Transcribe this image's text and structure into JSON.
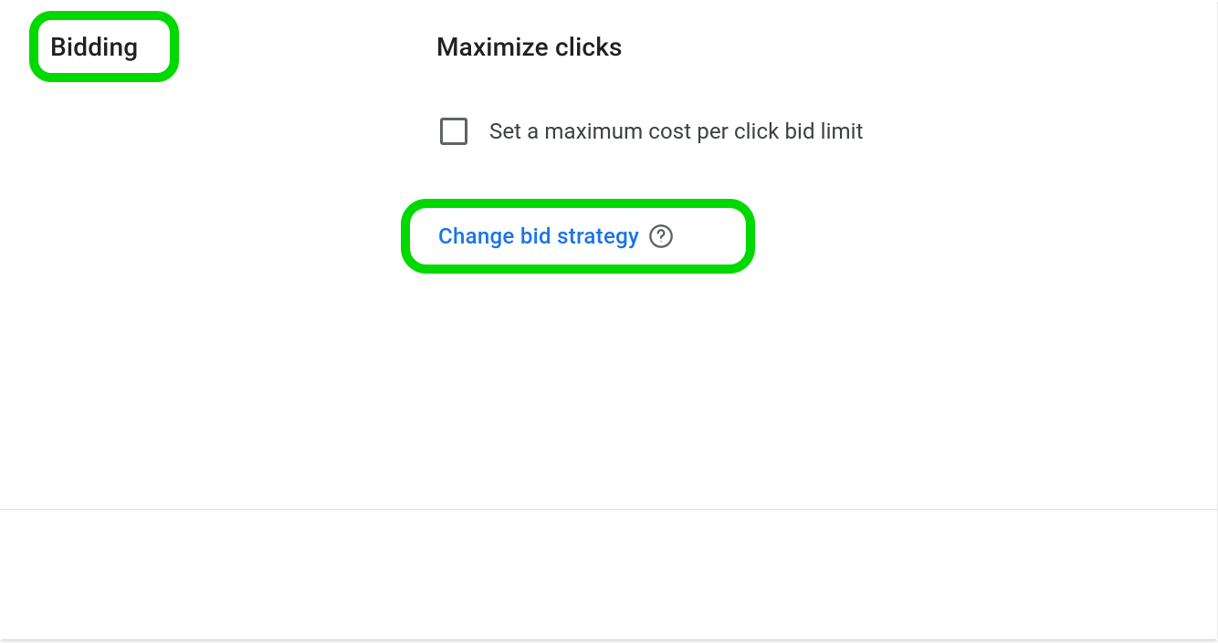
{
  "section": {
    "title": "Bidding"
  },
  "bidding": {
    "strategy_name": "Maximize clicks",
    "checkbox_label": "Set a maximum cost per click bid limit",
    "change_link_label": "Change bid strategy"
  },
  "highlights": {
    "accent_color": "#00d900"
  }
}
